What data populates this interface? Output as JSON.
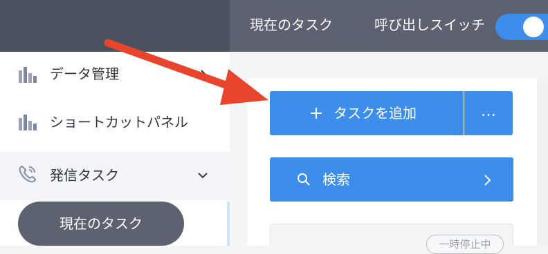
{
  "header": {
    "current_task": "現在のタスク",
    "call_switch_label": "呼び出しスイッチ",
    "call_switch_on": true
  },
  "sidebar": {
    "items": [
      {
        "label": "データ管理",
        "icon": "bar-chart-icon",
        "chevron": "chevron-right-icon"
      },
      {
        "label": "ショートカットパネル",
        "icon": "bar-chart-icon"
      },
      {
        "label": "発信タスク",
        "icon": "phone-icon",
        "chevron": "chevron-down-icon"
      }
    ],
    "active_sub_item": "現在のタスク"
  },
  "main": {
    "add_task_label": "タスクを追加",
    "add_task_icon": "plus-icon",
    "more_label": "…",
    "search_label": "検索",
    "search_icon": "search-icon",
    "status_badge": "一時停止中"
  },
  "colors": {
    "primary": "#3d8eea",
    "header_dark": "#4a5260",
    "header": "#5c6270",
    "annotation_arrow": "#e8452c"
  }
}
